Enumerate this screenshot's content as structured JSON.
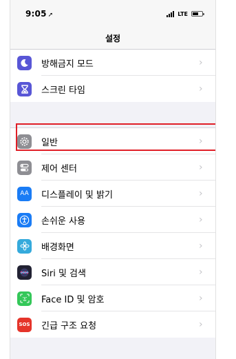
{
  "status": {
    "time": "9:05",
    "location_icon": "location-arrow-icon",
    "carrier": "LTE",
    "battery_level": 0.55
  },
  "nav": {
    "title": "설정"
  },
  "groups": [
    {
      "items": [
        {
          "label": "방해금지 모드",
          "icon": "moon-icon",
          "color": "#5856d6"
        },
        {
          "label": "스크린 타임",
          "icon": "hourglass-icon",
          "color": "#5856d6"
        }
      ]
    },
    {
      "items": [
        {
          "label": "일반",
          "icon": "gear-icon",
          "color": "#8e8e93"
        },
        {
          "label": "제어 센터",
          "icon": "switches-icon",
          "color": "#8e8e93"
        },
        {
          "label": "디스플레이 및 밝기",
          "icon": "text-size-icon",
          "icon_text": "AA",
          "color": "#1a7cf5"
        },
        {
          "label": "손쉬운 사용",
          "icon": "accessibility-icon",
          "color": "#1a7cf5"
        },
        {
          "label": "배경화면",
          "icon": "flower-icon",
          "color": "#35aadc"
        },
        {
          "label": "Siri 및 검색",
          "icon": "siri-icon",
          "color": "#222233"
        },
        {
          "label": "Face ID 및 암호",
          "icon": "face-id-icon",
          "color": "#34c759"
        },
        {
          "label": "긴급 구조 요청",
          "icon": "sos-icon",
          "icon_text": "SOS",
          "color": "#e5342a"
        }
      ]
    }
  ],
  "highlight_color": "#e01e26"
}
